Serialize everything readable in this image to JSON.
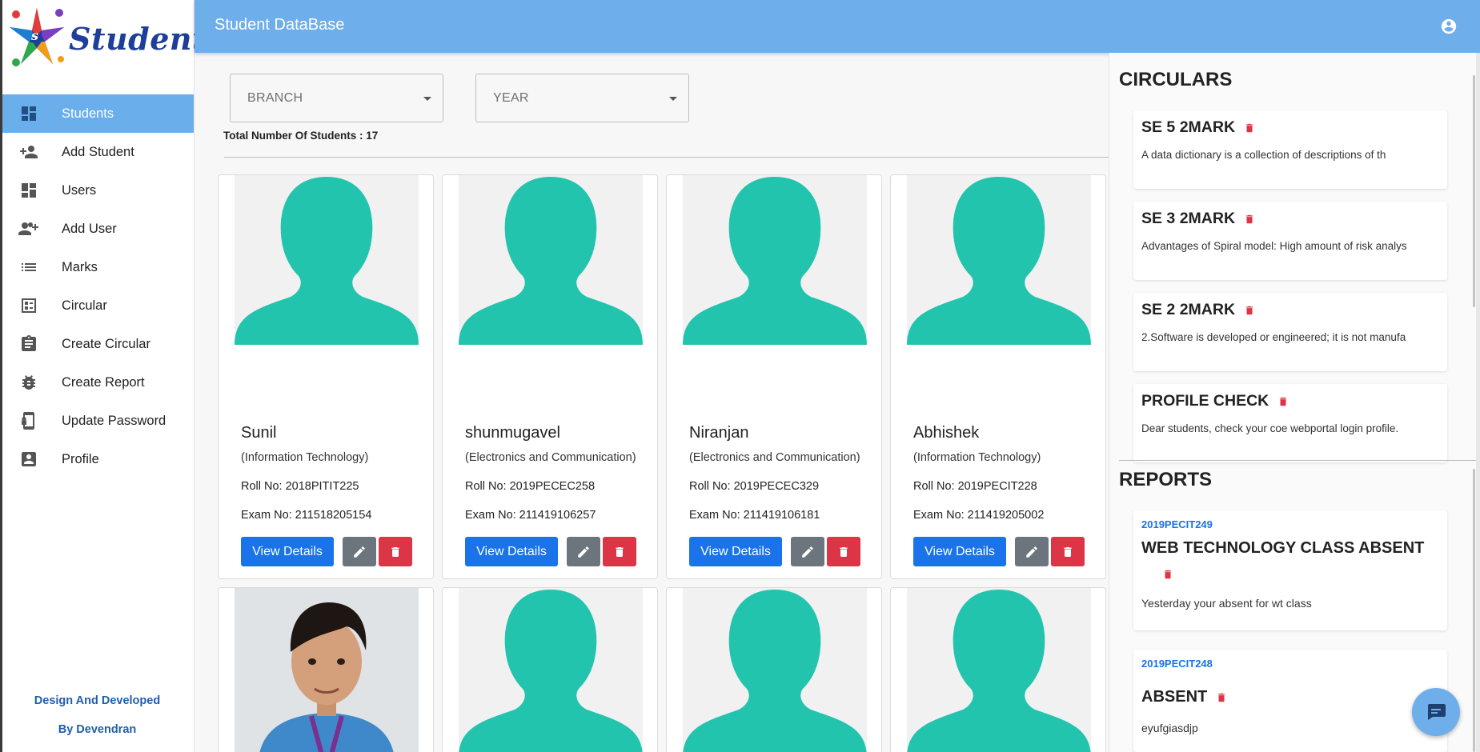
{
  "app": {
    "logo_text": "Student",
    "header_title": "Student DataBase"
  },
  "sidebar": {
    "items": [
      {
        "label": "Students",
        "icon": "dashboard-icon",
        "active": true
      },
      {
        "label": "Add Student",
        "icon": "person-add-icon"
      },
      {
        "label": "Users",
        "icon": "dashboard-icon"
      },
      {
        "label": "Add User",
        "icon": "group-add-icon"
      },
      {
        "label": "Marks",
        "icon": "list-icon"
      },
      {
        "label": "Circular",
        "icon": "dashboard-list-icon"
      },
      {
        "label": "Create Circular",
        "icon": "clipboard-icon"
      },
      {
        "label": "Create Report",
        "icon": "bug-icon"
      },
      {
        "label": "Update Password",
        "icon": "phone-lock-icon"
      },
      {
        "label": "Profile",
        "icon": "account-box-icon"
      }
    ],
    "credit_line1": "Design And Developed",
    "credit_line2": "By Devendran"
  },
  "filters": {
    "branch_placeholder": "BRANCH",
    "year_placeholder": "YEAR",
    "total_label": "Total Number Of Students : 17"
  },
  "students": [
    {
      "name": "Sunil",
      "dept": "(Information Technology)",
      "roll": "Roll No: 2018PITIT225",
      "exam": "Exam No: 211518205154",
      "photo": "avatar-placeholder"
    },
    {
      "name": "shunmugavel",
      "dept": "(Electronics and Communication)",
      "roll": "Roll No: 2019PECEC258",
      "exam": "Exam No: 211419106257",
      "photo": "avatar-placeholder"
    },
    {
      "name": "Niranjan",
      "dept": "(Electronics and Communication)",
      "roll": "Roll No: 2019PECEC329",
      "exam": "Exam No: 211419106181",
      "photo": "avatar-placeholder"
    },
    {
      "name": "Abhishek",
      "dept": "(Information Technology)",
      "roll": "Roll No: 2019PECIT228",
      "exam": "Exam No: 211419205002",
      "photo": "avatar-placeholder"
    },
    {
      "photo": "student-photo"
    },
    {
      "photo": "avatar-placeholder"
    },
    {
      "photo": "avatar-placeholder"
    },
    {
      "photo": "avatar-placeholder"
    }
  ],
  "card_actions": {
    "view_label": "View Details"
  },
  "circulars": {
    "title": "CIRCULARS",
    "items": [
      {
        "title": "SE 5 2MARK",
        "desc": "A data dictionary is a collection of descriptions of th"
      },
      {
        "title": "SE 3 2MARK",
        "desc": "Advantages of Spiral model: High amount of risk analys"
      },
      {
        "title": "SE 2 2MARK",
        "desc": "2.Software is developed or engineered; it is not manufa"
      },
      {
        "title": "PROFILE CHECK",
        "desc": "Dear students, check your coe webportal login profile."
      }
    ]
  },
  "reports": {
    "title": "REPORTS",
    "items": [
      {
        "roll": "2019PECIT249",
        "title": "WEB TECHNOLOGY CLASS ABSENT",
        "desc": "Yesterday your absent for wt class"
      },
      {
        "roll": "2019PECIT248",
        "title": "ABSENT",
        "desc": "eyufgiasdjp"
      }
    ]
  },
  "colors": {
    "header": "#6eaeea",
    "active_nav": "#6aaeeb",
    "primary": "#1a73e8",
    "danger": "#dc3545",
    "secondary": "#6c757d",
    "avatar": "#22c4ae"
  }
}
